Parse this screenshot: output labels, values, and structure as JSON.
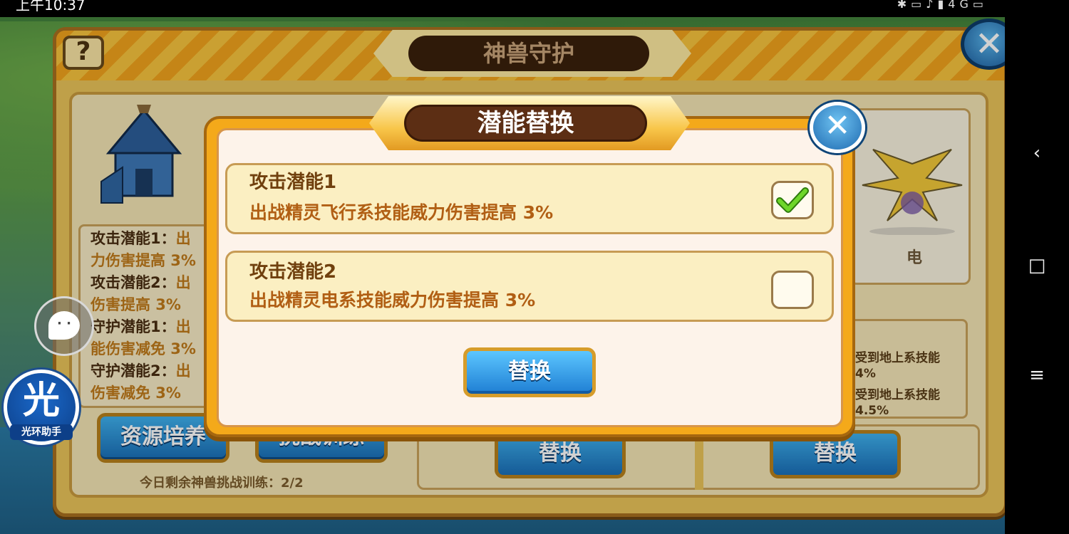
{
  "status_bar": {
    "time": "上午10:37",
    "network": "4G"
  },
  "main_window": {
    "title": "神兽守护",
    "help_label": "?",
    "close_label": "✕",
    "left_info": [
      {
        "label": "攻击潜能1：",
        "part_dark": "出",
        "part_orange": "力伤害提高 3%"
      },
      {
        "label": "攻击潜能2：",
        "part_dark": "出",
        "part_orange": "伤害提高 3%"
      },
      {
        "label": "守护潜能1：",
        "part_dark": "出",
        "part_orange": "能伤害减免 3%"
      },
      {
        "label": "守护潜能2：",
        "part_dark": "出",
        "part_orange": "伤害减免 3%"
      }
    ],
    "resource_button": "资源培养",
    "challenge_button": "挑战训练",
    "remain_text": "今日剩余神兽挑战训练：2/2",
    "element_label": "电",
    "right_info": [
      "受到地上系技能",
      "4%",
      "受到地上系技能",
      "4.5%"
    ],
    "swap_button_1": "替换",
    "swap_button_2": "替换"
  },
  "dialog": {
    "title": "潜能替换",
    "close_label": "✕",
    "options": [
      {
        "title": "攻击潜能1",
        "description": "出战精灵飞行系技能威力伤害提高 3%",
        "checked": true
      },
      {
        "title": "攻击潜能2",
        "description": "出战精灵电系技能威力伤害提高 3%",
        "checked": false
      }
    ],
    "confirm_button": "替换"
  },
  "side_widgets": {
    "halo_char": "光",
    "halo_label": "光环助手"
  },
  "nav_bar": {
    "back": "‹",
    "home": "□",
    "menu": "≡"
  },
  "colors": {
    "dialog_frame": "#f4a91a",
    "dialog_body": "#fdf3ea",
    "title_pill": "#5c2e14",
    "button_blue": "#1e7ed3",
    "check_green": "#5cc21c"
  }
}
